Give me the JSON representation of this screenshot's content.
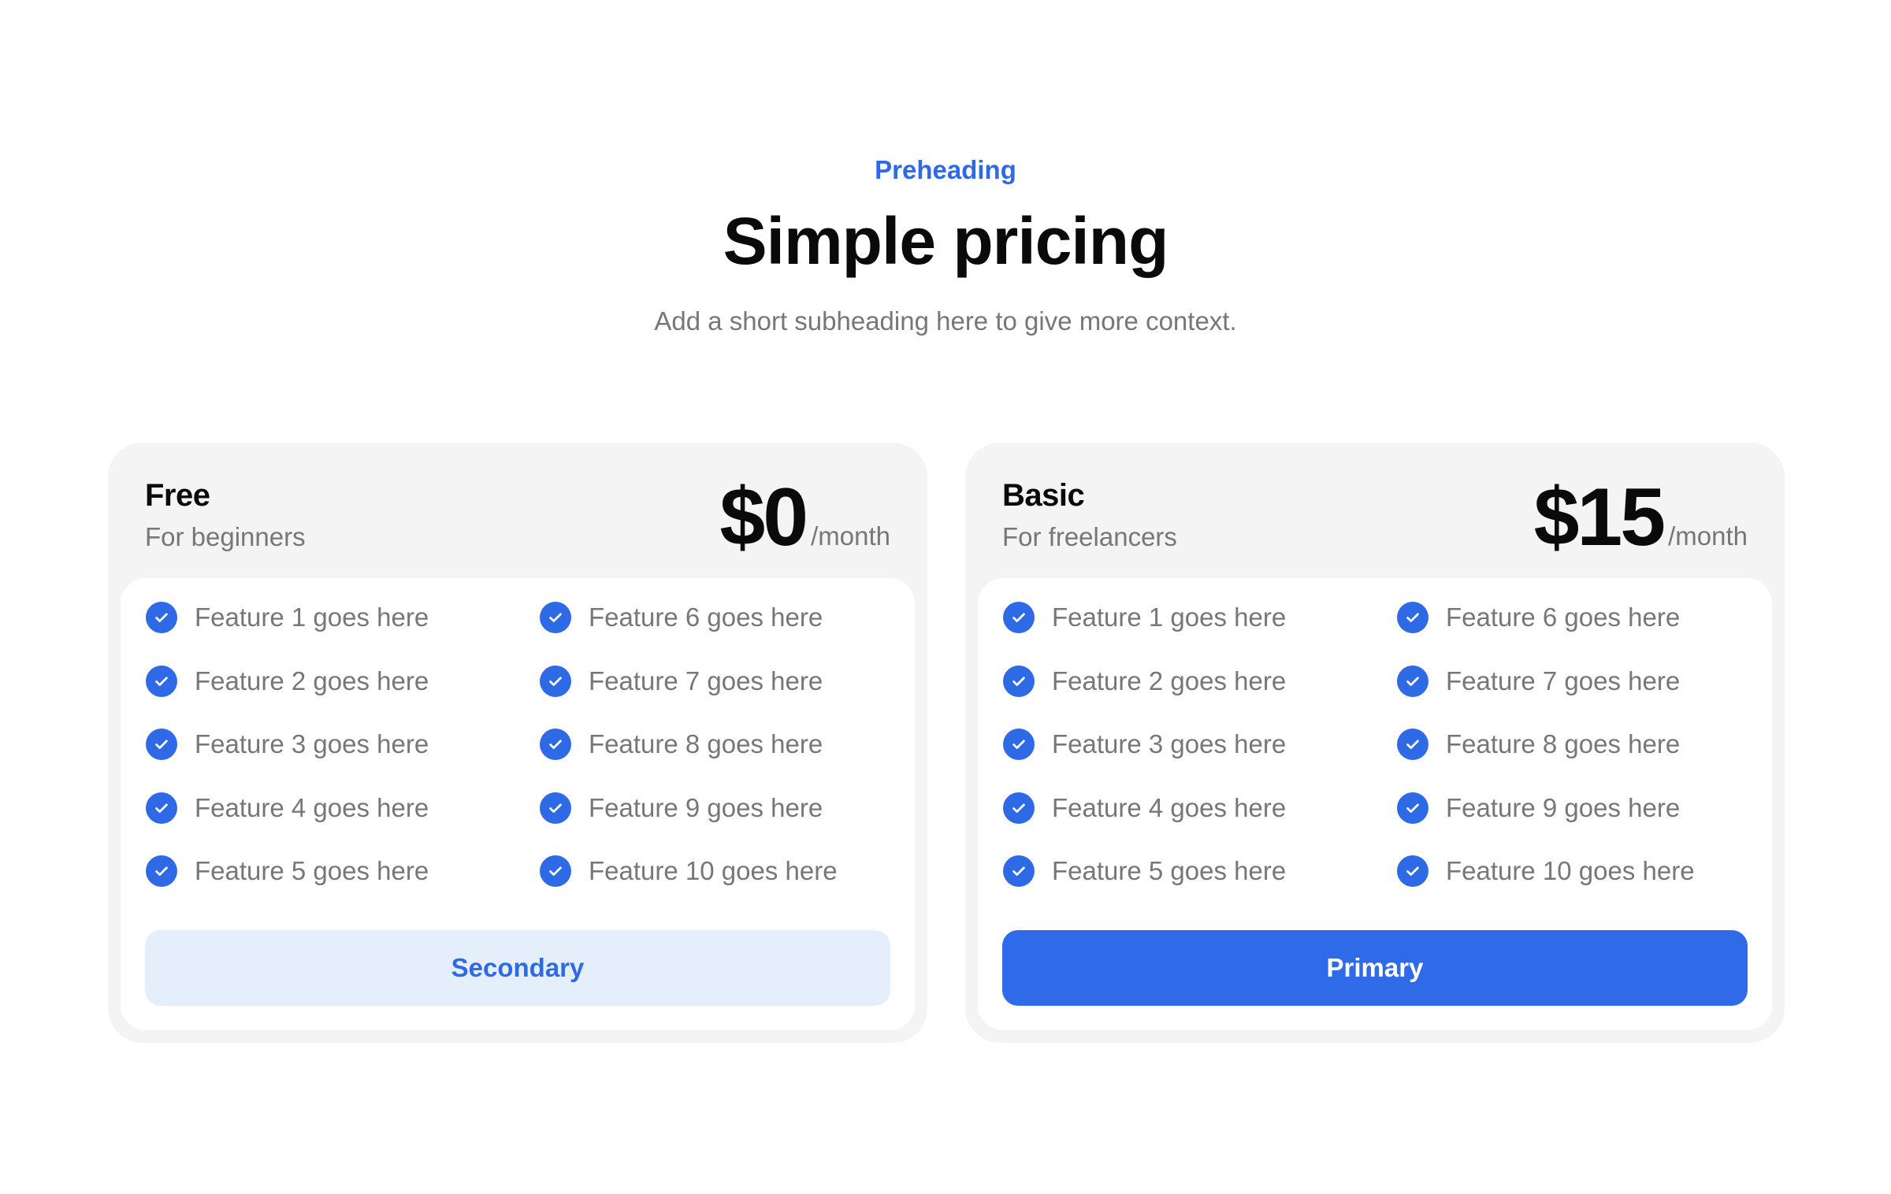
{
  "header": {
    "preheading": "Preheading",
    "title": "Simple pricing",
    "subheading": "Add a short subheading here to give more context."
  },
  "colors": {
    "accent": "#2f6ae6",
    "text_muted": "#777777",
    "card_bg": "#f4f4f4",
    "secondary_bg": "#e5effc"
  },
  "plans": [
    {
      "name": "Free",
      "description": "For beginners",
      "price": "$0",
      "period": "/month",
      "button_label": "Secondary",
      "features": [
        "Feature 1 goes here",
        "Feature 2 goes here",
        "Feature 3 goes here",
        "Feature 4 goes here",
        "Feature 5 goes here",
        "Feature 6 goes here",
        "Feature 7 goes here",
        "Feature 8 goes here",
        "Feature 9 goes here",
        "Feature 10 goes here"
      ]
    },
    {
      "name": "Basic",
      "description": "For freelancers",
      "price": "$15",
      "period": "/month",
      "button_label": "Primary",
      "features": [
        "Feature 1 goes here",
        "Feature 2 goes here",
        "Feature 3 goes here",
        "Feature 4 goes here",
        "Feature 5 goes here",
        "Feature 6 goes here",
        "Feature 7 goes here",
        "Feature 8 goes here",
        "Feature 9 goes here",
        "Feature 10 goes here"
      ]
    }
  ],
  "icons": {
    "feature_check": "check-circle-icon"
  }
}
